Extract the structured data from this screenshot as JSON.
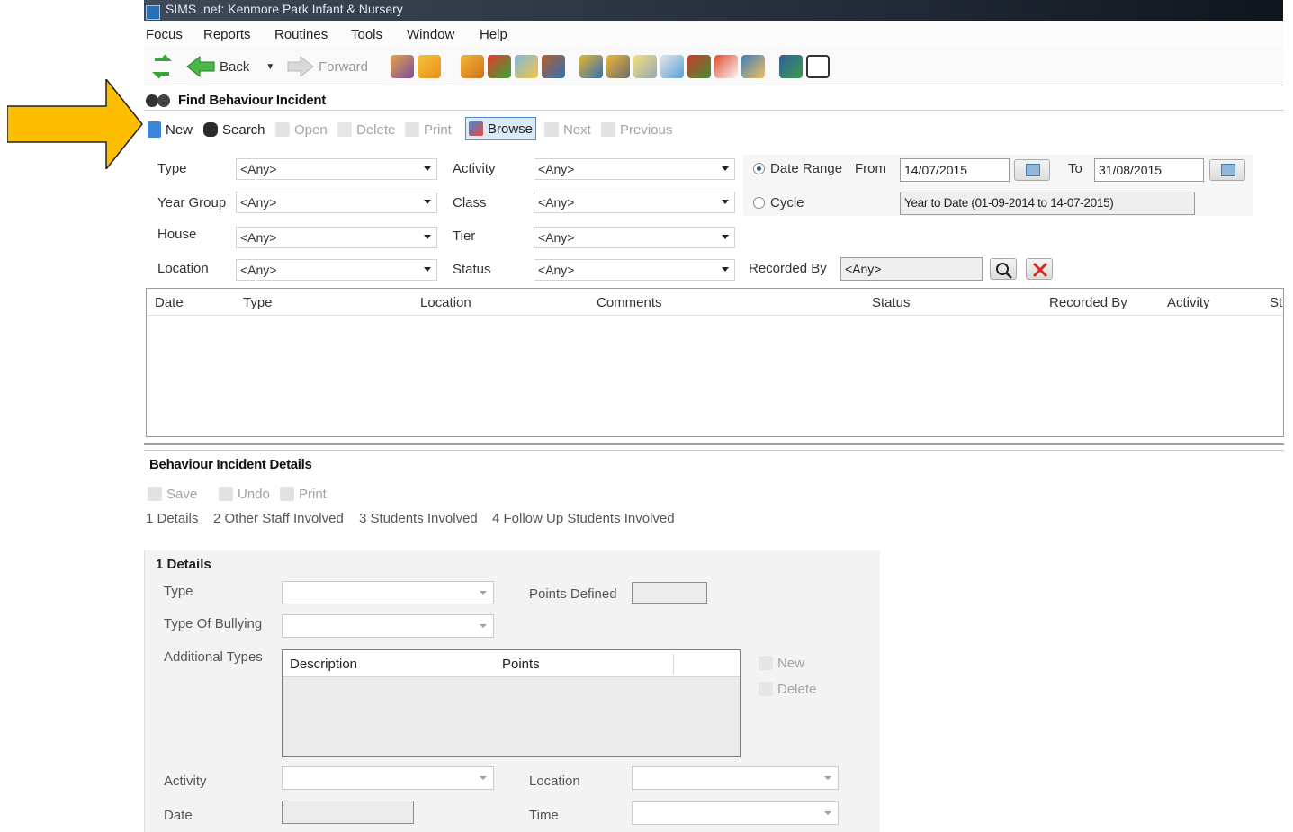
{
  "window_title": "SIMS .net: Kenmore Park Infant & Nursery",
  "menu": [
    "Focus",
    "Reports",
    "Routines",
    "Tools",
    "Window",
    "Help"
  ],
  "toolbar": {
    "back_label": "Back",
    "forward_label": "Forward"
  },
  "find": {
    "title": "Find Behaviour Incident",
    "actions": {
      "new": "New",
      "search": "Search",
      "open": "Open",
      "delete": "Delete",
      "print": "Print",
      "browse": "Browse",
      "next": "Next",
      "previous": "Previous"
    },
    "filters": {
      "type_label": "Type",
      "type_value": "<Any>",
      "year_group_label": "Year Group",
      "year_group_value": "<Any>",
      "house_label": "House",
      "house_value": "<Any>",
      "location_label": "Location",
      "location_value": "<Any>",
      "activity_label": "Activity",
      "activity_value": "<Any>",
      "class_label": "Class",
      "class_value": "<Any>",
      "tier_label": "Tier",
      "tier_value": "<Any>",
      "status_label": "Status",
      "status_value": "<Any>",
      "date_range_label": "Date Range",
      "from_label": "From",
      "from_value": "14/07/2015",
      "to_label": "To",
      "to_value": "31/08/2015",
      "cycle_label": "Cycle",
      "cycle_value": "Year to Date (01-09-2014 to 14-07-2015)",
      "recorded_by_label": "Recorded By",
      "recorded_by_value": "<Any>"
    },
    "results_columns": [
      "Date",
      "Type",
      "Location",
      "Comments",
      "Status",
      "Recorded By",
      "Activity",
      "St"
    ]
  },
  "details": {
    "title": "Behaviour Incident Details",
    "actions": {
      "save": "Save",
      "undo": "Undo",
      "print": "Print"
    },
    "tabs": [
      "1 Details",
      "2 Other Staff Involved",
      "3 Students Involved",
      "4 Follow Up Students Involved"
    ],
    "panel_title": "1 Details",
    "type_label": "Type",
    "points_defined_label": "Points Defined",
    "type_of_bullying_label": "Type Of Bullying",
    "additional_types_label": "Additional Types",
    "additional_columns": [
      "Description",
      "Points"
    ],
    "additional_new": "New",
    "additional_delete": "Delete",
    "activity_label": "Activity",
    "location_label": "Location",
    "date_label": "Date",
    "time_label": "Time"
  },
  "colors": {
    "arrow_fill": "#FDBE00",
    "browse_highlight": "#DBE9F9",
    "panel_bg": "#F3F3F3"
  }
}
